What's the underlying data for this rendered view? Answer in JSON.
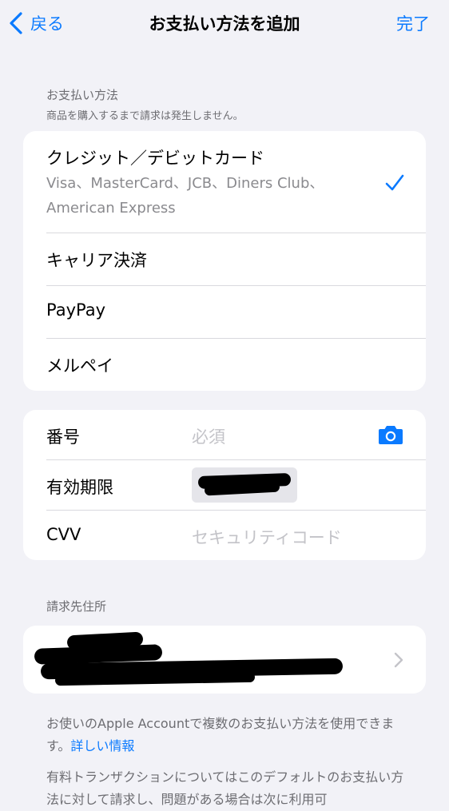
{
  "nav": {
    "back_label": "戻る",
    "title": "お支払い方法を追加",
    "done_label": "完了"
  },
  "payment_section": {
    "header": "お支払い方法",
    "subheader": "商品を購入するまで請求は発生しません。",
    "options": [
      {
        "title": "クレジット／デビットカード",
        "detail_line1": "Visa、MasterCard、JCB、Diners Club、",
        "detail_line2": "American Express",
        "selected": true
      },
      {
        "title": "キャリア決済"
      },
      {
        "title": "PayPay"
      },
      {
        "title": "メルペイ"
      }
    ]
  },
  "card_form": {
    "number_label": "番号",
    "number_placeholder": "必須",
    "expiry_label": "有効期限",
    "cvv_label": "CVV",
    "cvv_placeholder": "セキュリティコード"
  },
  "billing": {
    "header": "請求先住所"
  },
  "footer": {
    "text1": "お使いのApple Accountで複数のお支払い方法を使用できます。",
    "link": "詳しい情報",
    "text2": "有料トランザクションについてはこのデフォルトのお支払い方法に対して請求し、問題がある場合は次に利用可"
  },
  "colors": {
    "accent": "#0a7aff",
    "background": "#f2f2f7"
  },
  "icons": [
    "chevron-left-icon",
    "checkmark-icon",
    "camera-icon",
    "chevron-right-icon"
  ]
}
